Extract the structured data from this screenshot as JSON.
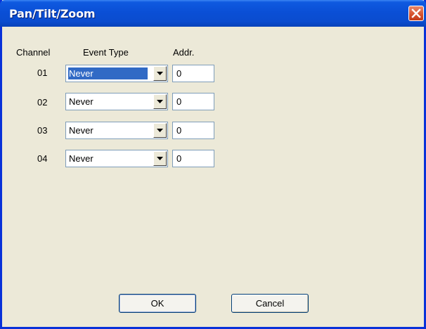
{
  "window": {
    "title": "Pan/Tilt/Zoom"
  },
  "headers": {
    "channel": "Channel",
    "event_type": "Event Type",
    "addr": "Addr."
  },
  "rows": [
    {
      "channel": "01",
      "event_type": "Never",
      "addr": "0"
    },
    {
      "channel": "02",
      "event_type": "Never",
      "addr": "0"
    },
    {
      "channel": "03",
      "event_type": "Never",
      "addr": "0"
    },
    {
      "channel": "04",
      "event_type": "Never",
      "addr": "0"
    }
  ],
  "buttons": {
    "ok": "OK",
    "cancel": "Cancel"
  },
  "colors": {
    "title_bar": "#0a4fd6",
    "close_button": "#d5502c",
    "selection": "#316ac5",
    "dialog_background": "#ece9d8"
  }
}
